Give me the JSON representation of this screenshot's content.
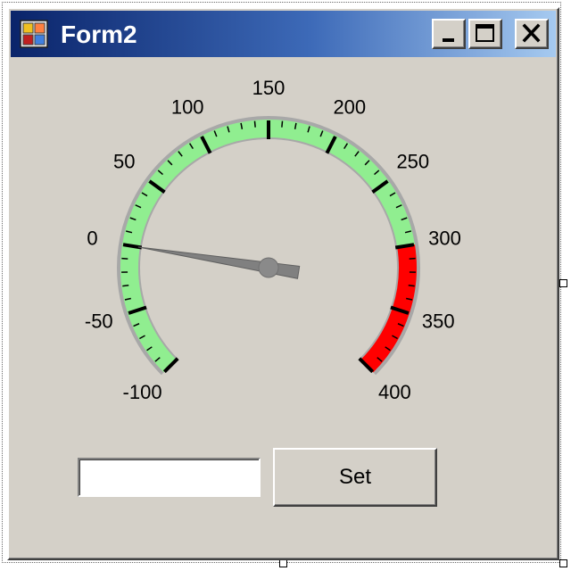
{
  "window": {
    "title": "Form2",
    "buttons": {
      "minimize": "minimize-icon",
      "maximize": "maximize-icon",
      "close": "close-icon"
    }
  },
  "gauge": {
    "min": -100,
    "max": 400,
    "value": 0,
    "tick_labels": [
      "-100",
      "-50",
      "0",
      "50",
      "100",
      "150",
      "200",
      "250",
      "300",
      "350",
      "400"
    ],
    "ranges": [
      {
        "from": -100,
        "to": 300,
        "color": "#90ee90"
      },
      {
        "from": 300,
        "to": 400,
        "color": "#ff0000"
      }
    ],
    "needle_color": "#808080"
  },
  "input": {
    "value": "",
    "placeholder": ""
  },
  "set_button": {
    "label": "Set"
  },
  "colors": {
    "face": "#d4d0c8",
    "title_start": "#0a246a",
    "title_end": "#a6caf0"
  }
}
